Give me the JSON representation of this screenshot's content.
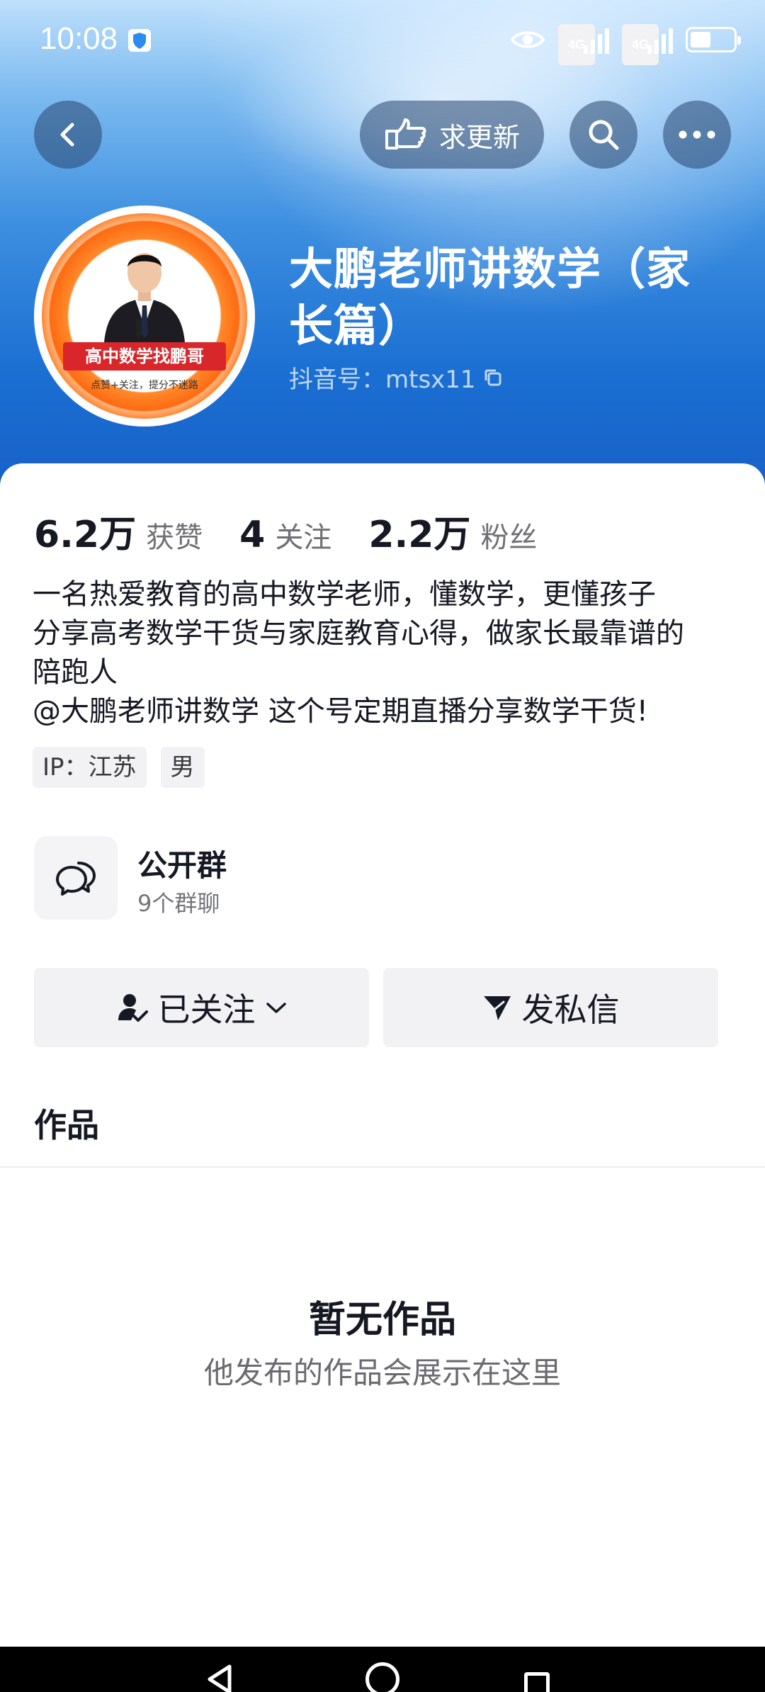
{
  "status_bar": {
    "time": "10:08",
    "network_1": "4G",
    "network_2": "4G",
    "icons": [
      "shield-icon",
      "eye-icon",
      "signal-icon",
      "battery-icon"
    ]
  },
  "top_nav": {
    "request_update_label": "求更新",
    "icons": [
      "back-icon",
      "pointing-hand-icon",
      "search-icon",
      "more-icon"
    ]
  },
  "profile": {
    "name": "大鹏老师讲数学（家长篇）",
    "douyin_id": "抖音号：mtsx11",
    "avatar": {
      "ribbon_text": "高中数学找鹏哥",
      "sub_text": "点赞+关注，提分不迷路"
    }
  },
  "stats": [
    {
      "value": "6.2万",
      "label": "获赞"
    },
    {
      "value": "4",
      "label": "关注"
    },
    {
      "value": "2.2万",
      "label": "粉丝"
    }
  ],
  "bio": {
    "lines": [
      "一名热爱教育的高中数学老师，懂数学，更懂孩子",
      "分享高考数学干货与家庭教育心得，做家长最靠谱的",
      "陪跑人",
      "@大鹏老师讲数学 这个号定期直播分享数学干货!"
    ]
  },
  "tags": [
    "IP：江苏",
    "男"
  ],
  "group": {
    "title": "公开群",
    "subtitle": "9个群聊"
  },
  "actions": {
    "followed_label": "已关注",
    "message_label": "发私信"
  },
  "works": {
    "title": "作品",
    "empty_title": "暂无作品",
    "empty_subtitle": "他发布的作品会展示在这里"
  },
  "colors": {
    "banner_top": "#bfe0fb",
    "banner_bottom": "#1760c8",
    "text_primary": "#161823",
    "button_bg": "#f2f2f4"
  }
}
